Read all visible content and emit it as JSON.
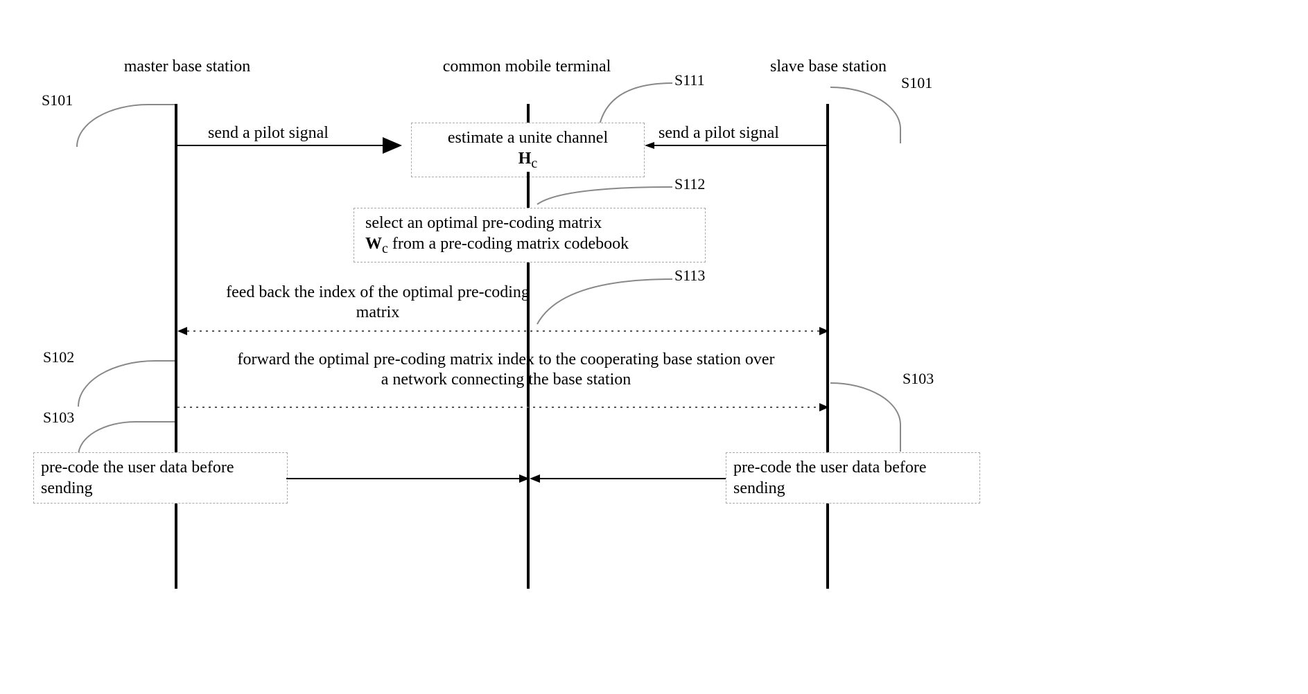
{
  "lanes": {
    "master": "master base station",
    "terminal": "common mobile terminal",
    "slave": "slave base station"
  },
  "steps": {
    "s101_left": "S101",
    "s101_right": "S101",
    "s111": "S111",
    "s112": "S112",
    "s113": "S113",
    "s102": "S102",
    "s103_left": "S103",
    "s103_right": "S103"
  },
  "messages": {
    "pilot_left": "send a pilot signal",
    "pilot_right": "send a pilot signal",
    "feedback": "feed back the index of the optimal pre-coding matrix",
    "forward": "forward the optimal pre-coding matrix index to the cooperating base station over a network connecting the base station"
  },
  "boxes": {
    "estimate": "estimate a unite channel",
    "estimate_sym": "H",
    "estimate_sub": "c",
    "select_line1": "select an optimal pre-coding matrix",
    "select_sym": "W",
    "select_sub": "c",
    "select_line2_tail": " from a pre-coding matrix codebook",
    "precode_left": "pre-code the user data before sending",
    "precode_right": "pre-code the user data before sending"
  }
}
